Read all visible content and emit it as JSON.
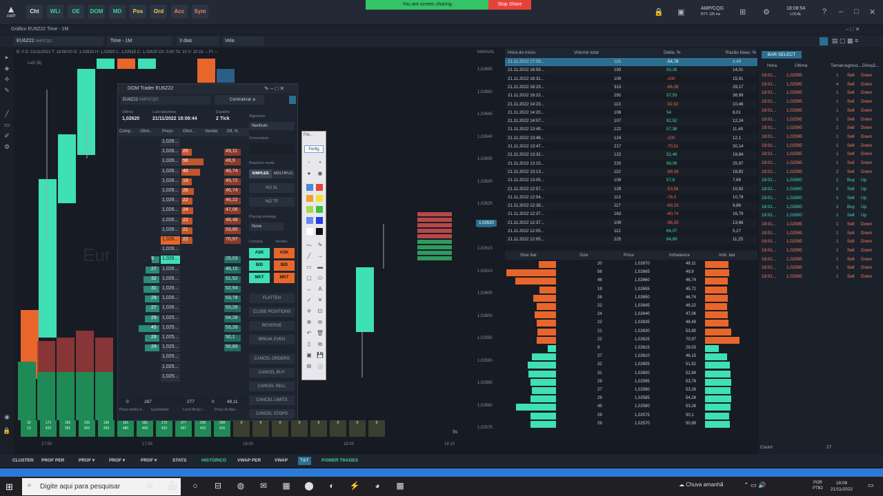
{
  "topbar": {
    "logo": "AMP",
    "buttons": [
      "Cht",
      "WLi",
      "OE",
      "DOM",
      "MD",
      "Pos",
      "Ord",
      "Acc",
      "Sym"
    ],
    "share_text": "You are screen sharing",
    "stop_share": "Stop Share",
    "connection": "AMP/CQG",
    "connection_sub": "RTT: 125 ms",
    "time": "18:08:54",
    "time_sub": "LOCAL"
  },
  "window": {
    "title": "Gráfico EU6Z22 Time - 1M",
    "symbol": "EU6Z22",
    "symbol_sub": "AMP/CQG",
    "timeframe": "Time - 1M",
    "range": "3 dias",
    "style": "Vela"
  },
  "chart": {
    "ohlc": "B: 0   D: 21/11/2022   T: 18:08:00   O: 1,02620   H: 1,02620   L: 1,02615   C: 1,02620   Ch: 0,00   Tk: 10   V: 10   Oi: --   Fi: --",
    "subtitle": "Lvl2 (9)",
    "watermark": "Eur                                   mber 2022",
    "mode": "MANUAL",
    "current_price": "1,02620",
    "price_labels": [
      "1,02655",
      "1,02650",
      "1,02645",
      "1,02640",
      "1,02635",
      "1,02630",
      "1,02625",
      "1,02620",
      "1,02615",
      "1,02610",
      "1,02605",
      "1,02600",
      "1,02595",
      "1,02590",
      "1,02585",
      "1,02580",
      "1,02575"
    ],
    "time_labels": [
      "17:50",
      "17:55",
      "18:00",
      "18:05",
      "18:10"
    ],
    "interval": "5s",
    "bottom_row": [
      "32\n13",
      "172\n423",
      "195\n391",
      "235\n403",
      "196\n393",
      "161\n480",
      "181\n409",
      "173\n423",
      "277\n467",
      "239\n423",
      "268\n416",
      "0",
      "0",
      "0",
      "0",
      "0",
      "0",
      "0",
      "0"
    ]
  },
  "dom": {
    "title": "DOM Trader EU6Z22",
    "symbol": "EU6Z22",
    "symbol_sub": "AMP/CQG",
    "last_label": "Última",
    "last": "1,02620",
    "lastdate_label": "Last data/time",
    "lastdate": "21/11/2022  18:08:44",
    "spread_label": "Espalhe",
    "spread": "2 Tick",
    "cols": [
      "Comp...",
      "Ofert...",
      "Preço",
      "Ofert...",
      "Vender",
      "Dfl, %"
    ],
    "footer": [
      "0",
      "287",
      "277",
      "0",
      "49,11"
    ],
    "footer_labels": [
      "Preço médio d...",
      "Quantidade",
      "Lucro Bruto / ...",
      "Preço de Apo..."
    ],
    "rows": [
      {
        "price": "1,026...",
        "ask": "",
        "bid": "",
        "dif": ""
      },
      {
        "price": "1,026...",
        "ask": "20",
        "bid": "",
        "dif": "49,11"
      },
      {
        "price": "1,026...",
        "ask": "56",
        "bid": "",
        "dif": "49,9"
      },
      {
        "price": "1,026...",
        "ask": "46",
        "bid": "",
        "dif": "46,74"
      },
      {
        "price": "1,026...",
        "ask": "19",
        "bid": "",
        "dif": "45,72"
      },
      {
        "price": "1,026...",
        "ask": "26",
        "bid": "",
        "dif": "46,74"
      },
      {
        "price": "1,026...",
        "ask": "22",
        "bid": "",
        "dif": "46,22"
      },
      {
        "price": "1,026...",
        "ask": "24",
        "bid": "",
        "dif": "47,06"
      },
      {
        "price": "1,026...",
        "ask": "22",
        "bid": "",
        "dif": "48,48"
      },
      {
        "price": "1,026...",
        "ask": "21",
        "bid": "",
        "dif": "53,85"
      },
      {
        "price": "1,026...",
        "ask": "22",
        "bid": "",
        "dif": "70,97"
      },
      {
        "price": "1,026...",
        "ask": "",
        "bid": "",
        "dif": ""
      },
      {
        "price": "1,026...",
        "ask": "",
        "bid": "9",
        "dif": "29,03"
      },
      {
        "price": "1,026...",
        "ask": "",
        "bid": "27",
        "dif": "46,15"
      },
      {
        "price": "1,026...",
        "ask": "",
        "bid": "32",
        "dif": "51,52"
      },
      {
        "price": "1,026...",
        "ask": "",
        "bid": "31",
        "dif": "52,94"
      },
      {
        "price": "1,026...",
        "ask": "",
        "bid": "29",
        "dif": "53,78"
      },
      {
        "price": "1,026...",
        "ask": "",
        "bid": "27",
        "dif": "53,26"
      },
      {
        "price": "1,025...",
        "ask": "",
        "bid": "29",
        "dif": "54,28"
      },
      {
        "price": "1,025...",
        "ask": "",
        "bid": "45",
        "dif": "53,26"
      },
      {
        "price": "1,025...",
        "ask": "",
        "bid": "29",
        "dif": "50,1"
      },
      {
        "price": "1,025...",
        "ask": "",
        "bid": "29",
        "dif": "50,89"
      },
      {
        "price": "1,025...",
        "ask": "",
        "bid": "",
        "dif": ""
      },
      {
        "price": "1,025...",
        "ask": "",
        "bid": "",
        "dif": ""
      },
      {
        "price": "1,025...",
        "ask": "",
        "bid": "",
        "dif": ""
      }
    ],
    "side": {
      "center": "Centralizar a",
      "algo_label": "Algoritmo",
      "algo": "Nenhum",
      "comment_label": "Comentário",
      "brackets_label": "Brackets mode",
      "simple": "SIMPLES",
      "multiple": "MÚLTIPLO",
      "nosl": "NO SL",
      "notp": "NO TP",
      "placing_label": "Placing strategy",
      "placing": "None",
      "buy_label": "Compra",
      "sell_label": "Vender",
      "ask": "ASK",
      "bid": "BID",
      "mkt": "MKT",
      "flatten": "FLATTEN",
      "close": "CLOSE POSITIONS",
      "reverse": "REVERSE",
      "breakeven": "BREAK EVEN",
      "cancel_orders": "CANCEL ORDERS",
      "cancel_buy": "CANCEL BUY",
      "cancel_sell": "CANCEL SELL",
      "cancel_limits": "CANCEL LIMITS",
      "cancel_stops": "CANCEL STOPS"
    }
  },
  "palette": {
    "title": "Pal...",
    "tab": "Ferfig"
  },
  "table": {
    "headers": [
      "Hora do início",
      "Volume total",
      "Delta, %",
      "Razão base, %"
    ],
    "rows": [
      [
        "21.11.2022 17:59...",
        "115",
        "-54,78",
        "3,49"
      ],
      [
        "21.11.2022 16:59...",
        "193",
        "50,26",
        "14,01"
      ],
      [
        "21.11.2022 16:31...",
        "109",
        "-100",
        "15,91"
      ],
      [
        "21.11.2022 16:23...",
        "313",
        "-66,38",
        "29,17"
      ],
      [
        "21.11.2022 16:22...",
        "292",
        "57,53",
        "38,99"
      ],
      [
        "21.11.2022 14:23...",
        "113",
        "-92,92",
        "10,46"
      ],
      [
        "21.11.2022 14:20...",
        "108",
        "54",
        "8,01"
      ],
      [
        "21.11.2022 14:07...",
        "107",
        "92,52",
        "12,24"
      ],
      [
        "21.11.2022 13:49...",
        "122",
        "57,38",
        "11,45"
      ],
      [
        "21.11.2022 13:49...",
        "124",
        "-100",
        "12,1"
      ],
      [
        "21.11.2022 13:47...",
        "217",
        "-70,51",
        "30,14"
      ],
      [
        "21.11.2022 13:32...",
        "122",
        "52,46",
        "19,84"
      ],
      [
        "21.11.2022 13:15...",
        "220",
        "99,09",
        "25,97"
      ],
      [
        "21.11.2022 13:13...",
        "110",
        "-89,38",
        "18,82"
      ],
      [
        "21.11.2022 13:05...",
        "109",
        "57,8",
        "7,69"
      ],
      [
        "21.11.2022 12:57...",
        "128",
        "-53,56",
        "10,92"
      ],
      [
        "21.11.2022 12:54...",
        "113",
        "-78,3",
        "10,79"
      ],
      [
        "21.11.2022 12:38...",
        "117",
        "-69,23",
        "9,86"
      ],
      [
        "21.11.2022 12:37...",
        "163",
        "-60,74",
        "16,79"
      ],
      [
        "21.11.2022 12:37...",
        "109",
        "-96,33",
        "13,66"
      ],
      [
        "21.11.2022 12:05...",
        "112",
        "66,07",
        "5,27"
      ],
      [
        "21.11.2022 12:05...",
        "225",
        "84,89",
        "11,25"
      ]
    ]
  },
  "sizebar": {
    "headers": [
      "Size bar",
      "Size",
      "Price",
      "Imbalance",
      "Imb. bar"
    ],
    "rows": [
      {
        "size": "20",
        "price": "1,02670",
        "imb": "49,11",
        "sb": 0.35,
        "ib": 0.49,
        "side": "sell"
      },
      {
        "size": "56",
        "price": "1,02665",
        "imb": "49,9",
        "sb": 1.0,
        "ib": 0.5,
        "side": "sell"
      },
      {
        "size": "46",
        "price": "1,02660",
        "imb": "46,74",
        "sb": 0.82,
        "ib": 0.47,
        "side": "sell"
      },
      {
        "size": "19",
        "price": "1,02655",
        "imb": "45,72",
        "sb": 0.34,
        "ib": 0.46,
        "side": "sell"
      },
      {
        "size": "26",
        "price": "1,02650",
        "imb": "46,74",
        "sb": 0.46,
        "ib": 0.47,
        "side": "sell"
      },
      {
        "size": "22",
        "price": "1,02645",
        "imb": "46,22",
        "sb": 0.39,
        "ib": 0.46,
        "side": "sell"
      },
      {
        "size": "24",
        "price": "1,02640",
        "imb": "47,06",
        "sb": 0.43,
        "ib": 0.47,
        "side": "sell"
      },
      {
        "size": "22",
        "price": "1,02635",
        "imb": "48,48",
        "sb": 0.39,
        "ib": 0.48,
        "side": "sell"
      },
      {
        "size": "21",
        "price": "1,02630",
        "imb": "53,85",
        "sb": 0.38,
        "ib": 0.54,
        "side": "sell"
      },
      {
        "size": "22",
        "price": "1,02625",
        "imb": "70,97",
        "sb": 0.39,
        "ib": 0.71,
        "side": "sell"
      },
      {
        "size": "9",
        "price": "1,02615",
        "imb": "29,03",
        "sb": 0.16,
        "ib": 0.29,
        "side": "buy"
      },
      {
        "size": "27",
        "price": "1,02610",
        "imb": "46,15",
        "sb": 0.48,
        "ib": 0.46,
        "side": "buy"
      },
      {
        "size": "32",
        "price": "1,02605",
        "imb": "51,52",
        "sb": 0.57,
        "ib": 0.52,
        "side": "buy"
      },
      {
        "size": "31",
        "price": "1,02600",
        "imb": "52,94",
        "sb": 0.55,
        "ib": 0.53,
        "side": "buy"
      },
      {
        "size": "29",
        "price": "1,02595",
        "imb": "53,78",
        "sb": 0.52,
        "ib": 0.54,
        "side": "buy"
      },
      {
        "size": "27",
        "price": "1,02590",
        "imb": "53,26",
        "sb": 0.48,
        "ib": 0.53,
        "side": "buy"
      },
      {
        "size": "29",
        "price": "1,02585",
        "imb": "54,28",
        "sb": 0.52,
        "ib": 0.54,
        "side": "buy"
      },
      {
        "size": "45",
        "price": "1,02580",
        "imb": "53,26",
        "sb": 0.8,
        "ib": 0.53,
        "side": "buy"
      },
      {
        "size": "29",
        "price": "1,02575",
        "imb": "50,1",
        "sb": 0.52,
        "ib": 0.5,
        "side": "buy"
      },
      {
        "size": "29",
        "price": "1,02570",
        "imb": "50,89",
        "sb": 0.52,
        "ib": 0.51,
        "side": "buy"
      }
    ]
  },
  "barselect": {
    "title": "BAR SELECT",
    "headers": [
      "Hora",
      "Última",
      "Taman...",
      "Agress...",
      "Direçã..."
    ],
    "rows": [
      [
        "18:01...",
        "1,02595",
        "1",
        "Sell",
        "Down"
      ],
      [
        "18:01...",
        "1,02595",
        "4",
        "Sell",
        "Down"
      ],
      [
        "18:01...",
        "1,02595",
        "1",
        "Sell",
        "Down"
      ],
      [
        "18:01...",
        "1,02595",
        "1",
        "Sell",
        "Down"
      ],
      [
        "18:01...",
        "1,02595",
        "1",
        "Sell",
        "Down"
      ],
      [
        "18:01...",
        "1,02595",
        "1",
        "Sell",
        "Down"
      ],
      [
        "18:01...",
        "1,02595",
        "1",
        "Sell",
        "Down"
      ],
      [
        "18:01...",
        "1,02595",
        "1",
        "Sell",
        "Down"
      ],
      [
        "18:01...",
        "1,02595",
        "1",
        "Sell",
        "Down"
      ],
      [
        "18:01...",
        "1,02595",
        "1",
        "Sell",
        "Down"
      ],
      [
        "18:01...",
        "1,02595",
        "1",
        "Sell",
        "Down"
      ],
      [
        "18:01...",
        "1,02595",
        "2",
        "Sell",
        "Down"
      ],
      [
        "18:01...",
        "1,02600",
        "1",
        "Buy",
        "Up"
      ],
      [
        "18:01...",
        "1,02600",
        "1",
        "Sell",
        "Up"
      ],
      [
        "18:01...",
        "1,02600",
        "1",
        "Sell",
        "Up"
      ],
      [
        "18:01...",
        "1,02600",
        "1",
        "Buy",
        "Up"
      ],
      [
        "18:01...",
        "1,02600",
        "1",
        "Sell",
        "Up"
      ],
      [
        "18:01...",
        "1,02595",
        "1",
        "Sell",
        "Down"
      ],
      [
        "18:01...",
        "1,02595",
        "1",
        "Sell",
        "Down"
      ],
      [
        "18:01...",
        "1,02595",
        "1",
        "Sell",
        "Down"
      ],
      [
        "18:01...",
        "1,02595",
        "1",
        "Sell",
        "Down"
      ],
      [
        "18:01...",
        "1,02595",
        "1",
        "Sell",
        "Down"
      ],
      [
        "18:01...",
        "1,02595",
        "1",
        "Sell",
        "Down"
      ],
      [
        "18:01...",
        "1,02595",
        "1",
        "Sell",
        "Down"
      ]
    ],
    "count_label": "Count:",
    "count": "27"
  },
  "bottomtabs": [
    "CLUSTER",
    "PROF PER",
    "PROF ▾",
    "PROF ▾",
    "PROF ▾",
    "STATS",
    "HISTÓRICO",
    "VWAP PER",
    "VWAP",
    "T&T",
    "POWER TRADES"
  ],
  "taskbar": {
    "search": "Digite aqui para pesquisar",
    "weather": "Chuva amanhã",
    "lang": "POR",
    "lang_sub": "PTB2",
    "time": "18:08",
    "date": "21/11/2022"
  },
  "colors": {
    "up": "#3fe0b5",
    "down": "#e8662c",
    "sell_dom": "#c2552c",
    "buy_dom": "#2b8a7a"
  }
}
